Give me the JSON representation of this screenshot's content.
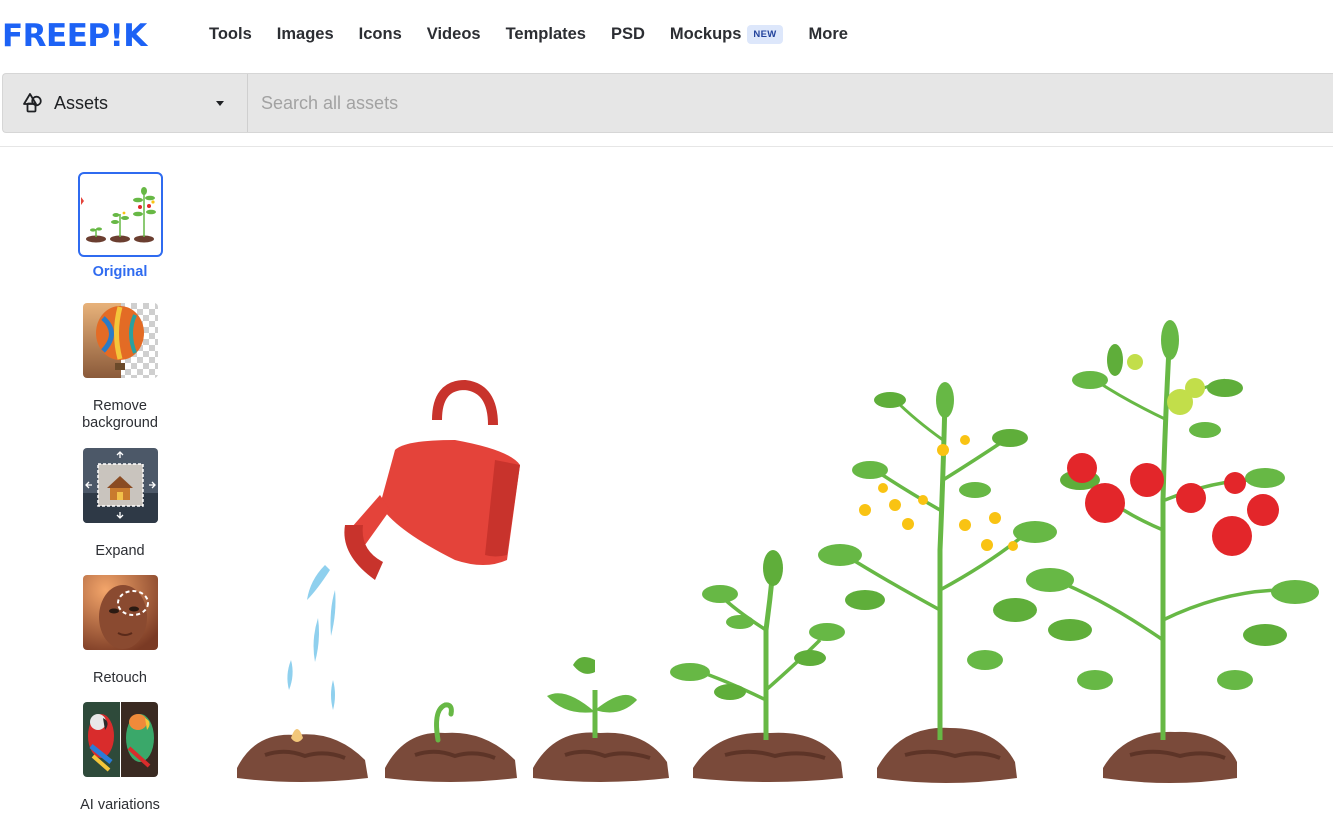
{
  "brand": {
    "logo_text": "FREEP!K",
    "accent_color": "#1d62f5"
  },
  "nav": {
    "items": [
      {
        "label": "Tools"
      },
      {
        "label": "Images"
      },
      {
        "label": "Icons"
      },
      {
        "label": "Videos"
      },
      {
        "label": "Templates"
      },
      {
        "label": "PSD"
      },
      {
        "label": "Mockups",
        "badge": "NEW"
      },
      {
        "label": "More"
      }
    ]
  },
  "search": {
    "asset_type": "Assets",
    "asset_icon": "shapes-icon",
    "placeholder": "Search all assets",
    "value": ""
  },
  "tools": [
    {
      "label": "Original",
      "icon": "original-thumbnail",
      "active": true
    },
    {
      "label": "Remove background",
      "icon": "remove-background-thumbnail",
      "active": false
    },
    {
      "label": "Expand",
      "icon": "expand-thumbnail",
      "active": false
    },
    {
      "label": "Retouch",
      "icon": "retouch-thumbnail",
      "active": false
    },
    {
      "label": "AI variations",
      "icon": "ai-variations-thumbnail",
      "active": false
    }
  ],
  "main_image": {
    "subject": "tomato-plant-growth-stages",
    "colors": {
      "soil": "#7a4a3a",
      "leaf": "#67b845",
      "can": "#e4433a",
      "tomato": "#e3262a",
      "flower": "#f9c313",
      "water": "#8fd0ee"
    }
  }
}
